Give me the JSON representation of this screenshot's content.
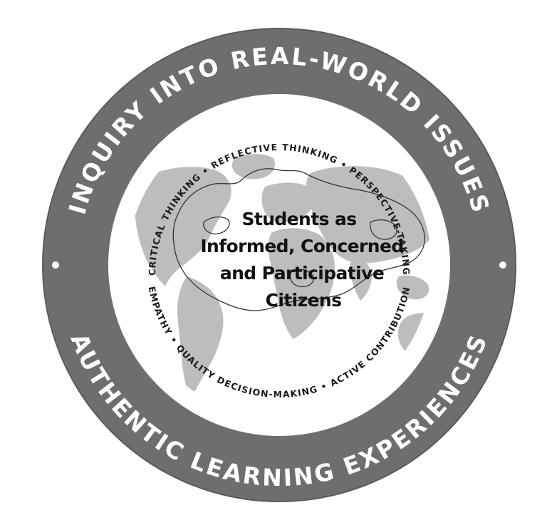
{
  "outer_ring": {
    "top_text": "INQUIRY INTO REAL-WORLD ISSUES",
    "bottom_text": "AUTHENTIC LEARNING EXPERIENCES"
  },
  "inner_ring": {
    "top_text": "CRITICAL THINKING • REFLECTIVE THINKING • PERSPECTIVE-TAKING",
    "bottom_text": "EMPATHY • QUALITY DECISION-MAKING • ACTIVE CONTRIBUTION"
  },
  "center": {
    "line1": "Students as",
    "line2": "Informed, Concerned",
    "line3": "and Participative",
    "line4": "Citizens"
  },
  "colors": {
    "outer_ring": "#6e6e6e",
    "map_fill": "#bdbdbd",
    "inner_background": "#ffffff",
    "text_dark": "#111111"
  },
  "icons": {
    "background_map": "world-map-icon",
    "highlight_outline": "singapore-outline-icon"
  }
}
